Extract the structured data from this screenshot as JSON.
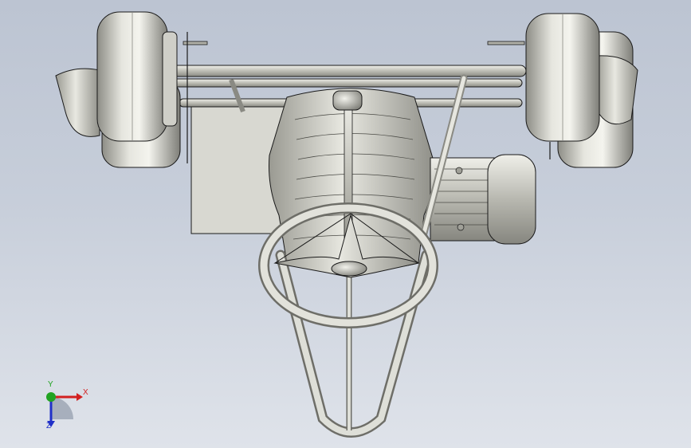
{
  "viewport": {
    "background_top": "#bcc4d2",
    "background_bottom": "#dfe3ea",
    "model_color": "#c9c9c1",
    "edge_color": "#1a1a1a"
  },
  "triad": {
    "x_label": "X",
    "y_label": "Y",
    "z_label": "Z",
    "x_color": "#d22020",
    "y_color": "#21a321",
    "z_color": "#2030c8"
  }
}
